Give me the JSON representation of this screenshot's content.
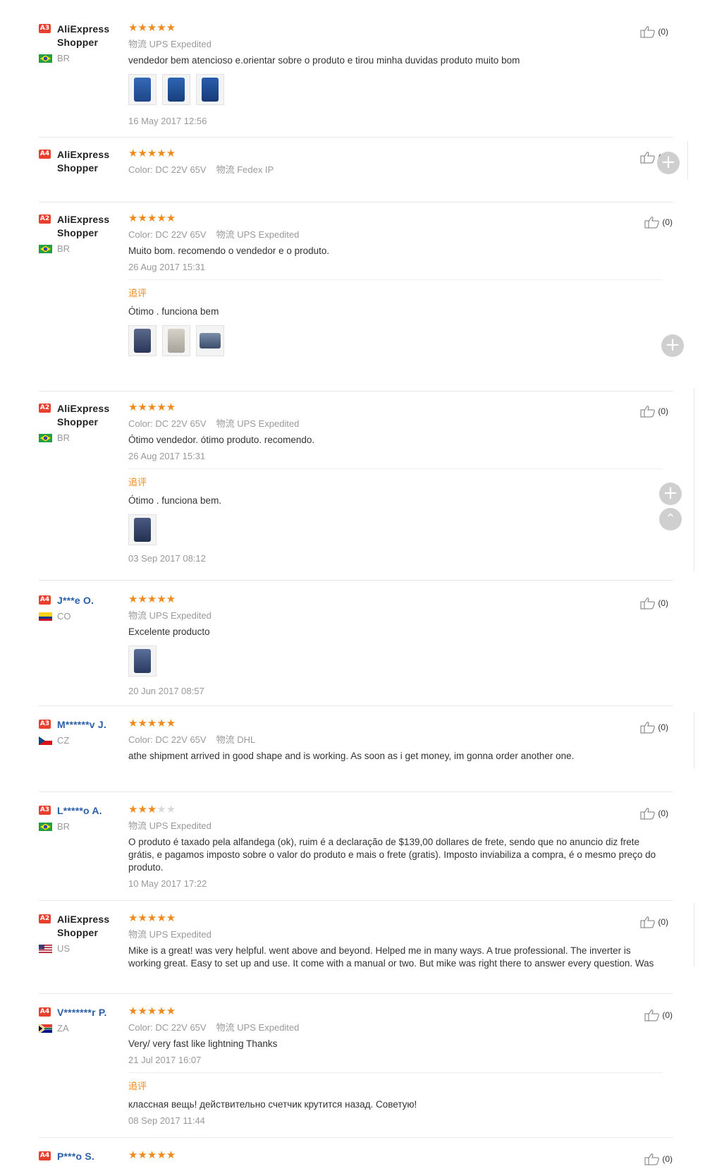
{
  "reviews": [
    {
      "badge": "A3",
      "name1": "AliExpress",
      "name2": "Shopper",
      "country": "BR",
      "stars": 5,
      "meta": [
        {
          "k": "物流",
          "v": "UPS Expedited"
        }
      ],
      "text": "vendedor bem atencioso e.orientar sobre o produto e tirou minha duvidas produto muito bom",
      "date": "16 May 2017 12:56",
      "likes": "(0)"
    },
    {
      "badge": "A4",
      "name1": "AliExpress",
      "name2": "Shopper",
      "country": "",
      "stars": 5,
      "meta": [
        {
          "k": "Color:",
          "v": "DC 22V 65V"
        },
        {
          "k": "物流",
          "v": "Fedex IP"
        }
      ],
      "likes": "(0)"
    },
    {
      "badge": "A2",
      "name1": "AliExpress",
      "name2": "Shopper",
      "country": "BR",
      "stars": 5,
      "meta": [
        {
          "k": "Color:",
          "v": "DC 22V 65V"
        },
        {
          "k": "物流",
          "v": "UPS Expedited"
        }
      ],
      "text": "Muito bom. recomendo o vendedor e o produto.",
      "date": "26 Aug 2017 15:31",
      "follow_label": "追评",
      "follow_text": "Ótimo . funciona bem",
      "likes": "(0)"
    },
    {
      "badge": "A2",
      "name1": "AliExpress",
      "name2": "Shopper",
      "country": "BR",
      "stars": 5,
      "meta": [
        {
          "k": "Color:",
          "v": "DC 22V 65V"
        },
        {
          "k": "物流",
          "v": "UPS Expedited"
        }
      ],
      "text": "Ótimo vendedor. ótimo produto. recomendo.",
      "date": "26 Aug 2017 15:31",
      "follow_label": "追评",
      "follow_text": "Ótimo . funciona bem.",
      "follow_date": "03 Sep 2017 08:12",
      "likes": "(0)"
    },
    {
      "badge": "A4",
      "name1": "J***e O.",
      "country": "CO",
      "stars": 5,
      "meta": [
        {
          "k": "物流",
          "v": "UPS Expedited"
        }
      ],
      "text": "Excelente producto",
      "date": "20 Jun 2017 08:57",
      "likes": "(0)"
    },
    {
      "badge": "A3",
      "name1": "M******v J.",
      "country": "CZ",
      "stars": 5,
      "meta": [
        {
          "k": "Color:",
          "v": "DC 22V 65V"
        },
        {
          "k": "物流",
          "v": "DHL"
        }
      ],
      "text": "athe shipment arrived in good shape and is working. As soon as i get money, im gonna order another one.",
      "likes": "(0)"
    },
    {
      "badge": "A3",
      "name1": "L*****o A.",
      "country": "BR",
      "stars": 3,
      "meta": [
        {
          "k": "物流",
          "v": "UPS Expedited"
        }
      ],
      "text": "O produto é taxado pela alfandega (ok), ruim é a declaração de $139,00 dollares de frete, sendo que no anuncio diz frete grátis, e pagamos imposto sobre o valor do produto e mais o frete (gratis). Imposto inviabiliza a compra, é o mesmo preço do produto.",
      "date": "10 May 2017 17:22",
      "likes": "(0)"
    },
    {
      "badge": "A2",
      "name1": "AliExpress",
      "name2": "Shopper",
      "country": "US",
      "stars": 5,
      "meta": [
        {
          "k": "物流",
          "v": "UPS Expedited"
        }
      ],
      "text": "Mike is a great! was very helpful. went above and beyond. Helped me in many ways. A true professional. The inverter is working great. Easy to set up and use. It come with a manual or two. But mike was right there to answer every question. Was",
      "likes": "(0)"
    },
    {
      "badge": "A4",
      "name1": "V*******r P.",
      "country": "ZA",
      "stars": 5,
      "meta": [
        {
          "k": "Color:",
          "v": "DC 22V 65V"
        },
        {
          "k": "物流",
          "v": "UPS Expedited"
        }
      ],
      "text": "Very/ very fast like lightning Thanks",
      "date": "21 Jul 2017 16:07",
      "follow_label": "追评",
      "follow_text": "классная вещь! действительно счетчик крутится назад. Советую!",
      "follow_date": "08 Sep 2017 11:44",
      "likes": "(0)"
    },
    {
      "badge": "A4",
      "name1": "P***o S.",
      "country": "",
      "stars": 5,
      "likes": "(0)"
    }
  ],
  "colors": {
    "accent": "#f08a1c",
    "badge": "#e8402f",
    "masked_name": "#2b5fa8"
  }
}
